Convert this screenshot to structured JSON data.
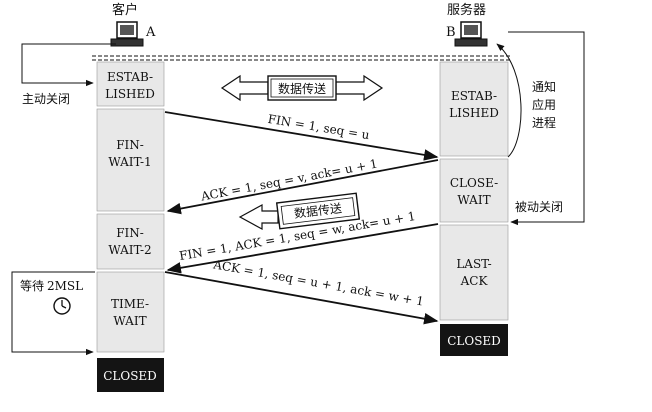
{
  "client": {
    "role_label": "客户",
    "letter": "A",
    "active_close": "主动关闭",
    "wait_line1": "等待",
    "wait_line2": "2MSL",
    "states": [
      "ESTAB-",
      "LISHED",
      "FIN-",
      "WAIT-1",
      "FIN-",
      "WAIT-2",
      "TIME-",
      "WAIT"
    ],
    "closed": "CLOSED"
  },
  "server": {
    "role_label": "服务器",
    "letter": "B",
    "notify_line1": "通知",
    "notify_line2": "应用",
    "notify_line3": "进程",
    "passive_close": "被动关闭",
    "states": [
      "ESTAB-",
      "LISHED",
      "CLOSE-",
      "WAIT",
      "LAST-",
      "ACK"
    ],
    "closed": "CLOSED"
  },
  "data_transfer": "数据传送",
  "messages": [
    "FIN = 1, seq = u",
    "ACK = 1, seq = v, ack= u + 1",
    "FIN = 1, ACK = 1, seq = w, ack= u + 1",
    "ACK = 1, seq = u + 1, ack = w + 1"
  ],
  "colors": {
    "column_fill": "#e8e8e8",
    "closed_fill": "#141414",
    "ink": "#111111"
  }
}
